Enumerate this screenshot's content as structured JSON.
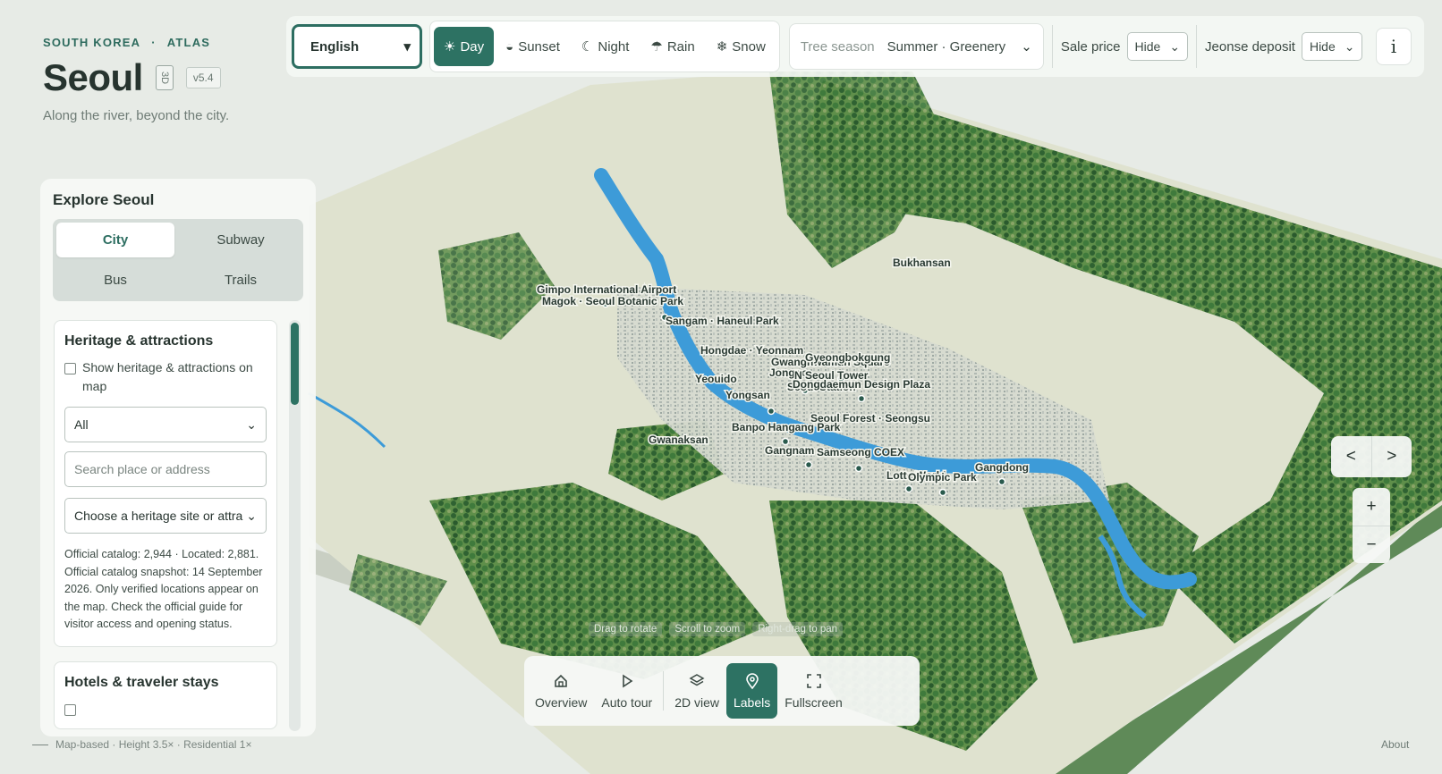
{
  "brand": {
    "country": "SOUTH KOREA",
    "dot": "·",
    "atlas": "ATLAS",
    "title": "Seoul",
    "badge_3d": "3D",
    "version": "v5.4",
    "tagline": "Along the river, beyond the city."
  },
  "topbar": {
    "language": "English",
    "weather": [
      {
        "icon": "sun-icon",
        "glyph": "☀",
        "label": "Day",
        "active": true
      },
      {
        "icon": "sunset-icon",
        "glyph": "◒",
        "label": "Sunset",
        "active": false
      },
      {
        "icon": "moon-icon",
        "glyph": "☾",
        "label": "Night",
        "active": false
      },
      {
        "icon": "umbrella-icon",
        "glyph": "☂",
        "label": "Rain",
        "active": false
      },
      {
        "icon": "snowflake-icon",
        "glyph": "❄",
        "label": "Snow",
        "active": false
      }
    ],
    "tree_season_label": "Tree season",
    "tree_season_value": "Summer · Greenery",
    "sale_price_label": "Sale price",
    "sale_price_value": "Hide",
    "jeonse_label": "Jeonse deposit",
    "jeonse_value": "Hide",
    "info_glyph": "i"
  },
  "panel": {
    "title": "Explore Seoul",
    "tabs": [
      "City",
      "Subway",
      "Bus",
      "Trails"
    ],
    "active_tab": "City",
    "heritage": {
      "title": "Heritage & attractions",
      "checkbox_label": "Show heritage & attractions on map",
      "filter_value": "All",
      "search_placeholder": "Search place or address",
      "choose_placeholder": "Choose a heritage site or attra",
      "note": "Official catalog: 2,944 · Located: 2,881. Official catalog snapshot: 14 September 2026. Only verified locations appear on the map. Check the official guide for visitor access and opening status."
    },
    "hotels": {
      "title": "Hotels & traveler stays"
    },
    "scroll_fraction": 0.2
  },
  "map": {
    "labels": [
      "Gimpo International Airport",
      "Magok · Seoul Botanic Park",
      "Sangam · Haneul Park",
      "Bukhansan",
      "Hongdae · Yeonnam",
      "Gwanghwamun Square",
      "Jongno",
      "Gyeongbokgung",
      "Seoul Station",
      "N Seoul Tower",
      "Yeouido",
      "Dongdaemun Design Plaza",
      "Yongsan",
      "Seoul Forest · Seongsu",
      "Banpo Hangang Park",
      "Gwanaksan",
      "Gangnam",
      "Samseong COEX",
      "Lotte World",
      "Olympic Park",
      "Gangdong"
    ],
    "hint": [
      "Drag to rotate",
      "Scroll to zoom",
      "Right-drag to pan"
    ]
  },
  "bottombar": [
    {
      "icon": "home-icon",
      "label": "Overview",
      "active": false
    },
    {
      "icon": "play-icon",
      "label": "Auto tour",
      "active": false
    },
    {
      "icon": "layers-icon",
      "label": "2D view",
      "active": false
    },
    {
      "icon": "map-pin-icon",
      "label": "Labels",
      "active": true
    },
    {
      "icon": "fullscreen-icon",
      "label": "Fullscreen",
      "active": false
    }
  ],
  "nav": {
    "prev": "<",
    "next": ">",
    "zoom_in": "+",
    "zoom_out": "−"
  },
  "footer": {
    "legend": "Map-based · Height 3.5× · Residential 1×",
    "about": "About"
  },
  "colors": {
    "accent": "#2d7263",
    "forest": "#3f7a3c",
    "river": "#3d9bd8",
    "land": "#d9ddc9"
  }
}
